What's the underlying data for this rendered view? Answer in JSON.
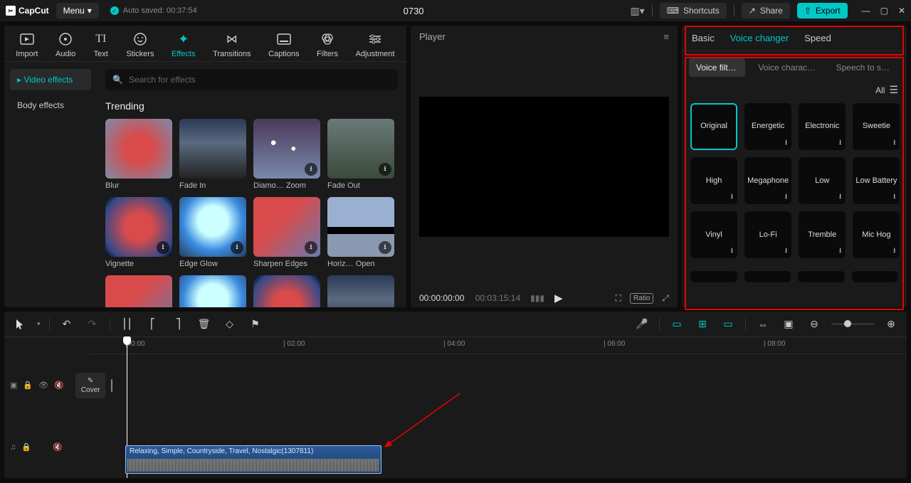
{
  "titlebar": {
    "logo": "CapCut",
    "menu": "Menu",
    "autosave": "Auto saved: 00:37:54",
    "project": "0730",
    "shortcuts": "Shortcuts",
    "share": "Share",
    "export": "Export"
  },
  "media_tabs": {
    "import": "Import",
    "audio": "Audio",
    "text": "Text",
    "stickers": "Stickers",
    "effects": "Effects",
    "transitions": "Transitions",
    "captions": "Captions",
    "filters": "Filters",
    "adjustment": "Adjustment"
  },
  "effects_sidebar": {
    "video": "▸ Video effects",
    "body": "Body effects"
  },
  "effects_panel": {
    "search_placeholder": "Search for effects",
    "trending": "Trending",
    "items": [
      {
        "label": "Blur",
        "cls": "th-blur",
        "dl": false
      },
      {
        "label": "Fade In",
        "cls": "th-fadein",
        "dl": false
      },
      {
        "label": "Diamo… Zoom",
        "cls": "th-diamo",
        "dl": true
      },
      {
        "label": "Fade Out",
        "cls": "th-fadeout",
        "dl": true
      },
      {
        "label": "Vignette",
        "cls": "th-vignette",
        "dl": true
      },
      {
        "label": "Edge Glow",
        "cls": "th-glow",
        "dl": true
      },
      {
        "label": "Sharpen Edges",
        "cls": "th-sharpen",
        "dl": true
      },
      {
        "label": "Horiz… Open",
        "cls": "th-horiz",
        "dl": true
      }
    ]
  },
  "player": {
    "title": "Player",
    "current": "00:00:00:00",
    "duration": "00:03:15:14",
    "ratio": "Ratio"
  },
  "inspector": {
    "tabs": {
      "basic": "Basic",
      "voice": "Voice changer",
      "speed": "Speed"
    },
    "subtabs": {
      "filters": "Voice filters",
      "chars": "Voice charact…",
      "s2s": "Speech to so…"
    },
    "all": "All",
    "voices": [
      {
        "label": "Original",
        "selected": true,
        "dl": false
      },
      {
        "label": "Energetic",
        "selected": false,
        "dl": true
      },
      {
        "label": "Electronic",
        "selected": false,
        "dl": true
      },
      {
        "label": "Sweetie",
        "selected": false,
        "dl": true
      },
      {
        "label": "High",
        "selected": false,
        "dl": true
      },
      {
        "label": "Megaphone",
        "selected": false,
        "dl": true
      },
      {
        "label": "Low",
        "selected": false,
        "dl": true
      },
      {
        "label": "Low Battery",
        "selected": false,
        "dl": true
      },
      {
        "label": "Vinyl",
        "selected": false,
        "dl": true
      },
      {
        "label": "Lo-Fi",
        "selected": false,
        "dl": true
      },
      {
        "label": "Tremble",
        "selected": false,
        "dl": true
      },
      {
        "label": "Mic Hog",
        "selected": false,
        "dl": true
      }
    ]
  },
  "timeline": {
    "cover": "Cover",
    "ticks": [
      "|00:00",
      "| 02:00",
      "| 04:00",
      "| 06:00",
      "| 08:00"
    ],
    "audio_clip": "Relaxing, Simple, Countryside, Travel, Nostalgic(1307811)"
  }
}
